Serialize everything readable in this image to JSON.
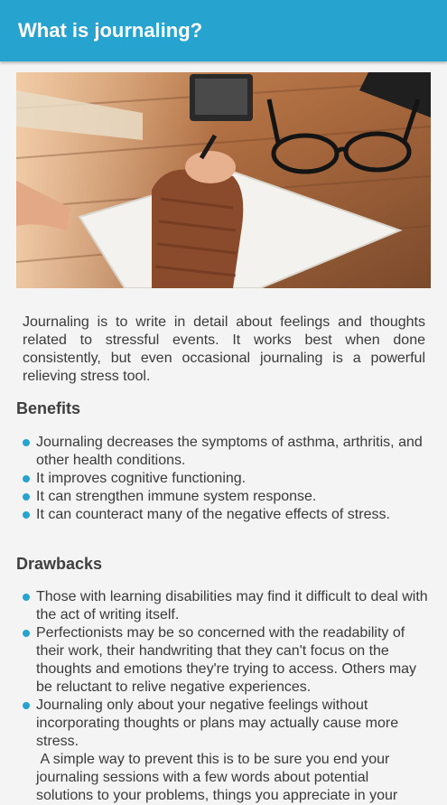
{
  "appbar": {
    "title": "What is journaling?"
  },
  "hero": {
    "image": "person-writing-in-notebook-photo"
  },
  "intro": "Journaling is to write in detail about feelings and thoughts related to stressful events. It works best when done consistently, but even occasional journaling is a powerful relieving stress tool.",
  "benefits": {
    "title": "Benefits",
    "items": [
      "Journaling decreases the symptoms of asthma, arthritis, and other health conditions.",
      "It improves cognitive functioning.",
      "It can strengthen immune system response.",
      "It can counteract many of the negative effects of stress."
    ]
  },
  "drawbacks": {
    "title": "Drawbacks",
    "items": [
      "Those with learning disabilities may find it difficult to deal with the act of writing itself.",
      "Perfectionists may be so concerned with the readability of their work, their handwriting that they can't focus on the thoughts and emotions they're trying to access. Others may be reluctant to relive negative experiences.",
      "Journaling only about your negative feelings without incorporating thoughts or plans may actually cause more stress."
    ],
    "extra": " A simple way to prevent this is to be sure you end your journaling sessions with a few words about potential solutions to your problems, things you appreciate in your"
  },
  "colors": {
    "accent": "#27a3cf",
    "background": "#f4f4f4"
  }
}
